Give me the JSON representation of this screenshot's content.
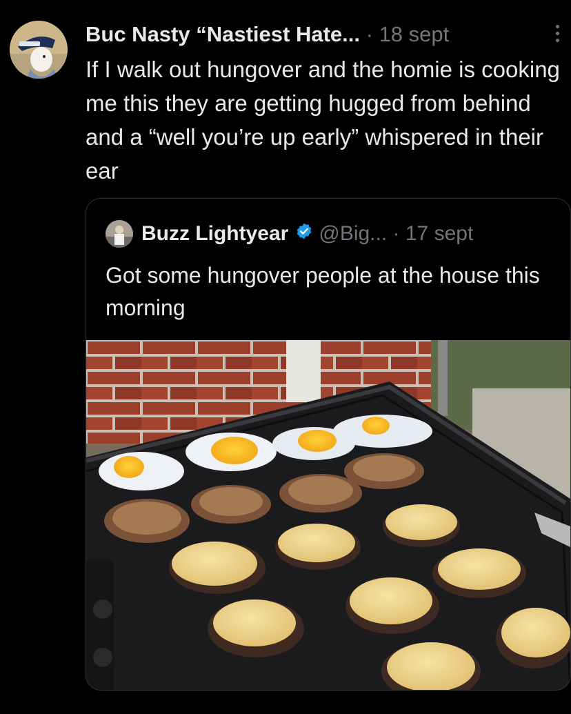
{
  "tweet": {
    "author_name": "Buc Nasty “Nastiest Hate...",
    "separator": "·",
    "date": "18 sept",
    "text": "If I walk out hungover and the homie is cooking me this they are getting hugged from behind and a “well you’re up early” whispered in their ear",
    "avatar_icon": "cartoon-avatar-icon",
    "more_icon": "more-options-icon"
  },
  "quote": {
    "author_name": "Buzz Lightyear",
    "handle": "@Big...",
    "separator": "·",
    "date": "17 sept",
    "text": "Got some hungover people at the house this morning",
    "verified_icon": "verified-badge-icon",
    "verified_color": "#1d9bf0",
    "photo_description_icon": "griddle-breakfast-photo"
  },
  "colors": {
    "background": "#000000",
    "text": "#e7e9ea",
    "muted": "#71767b",
    "border": "#2f3336"
  }
}
